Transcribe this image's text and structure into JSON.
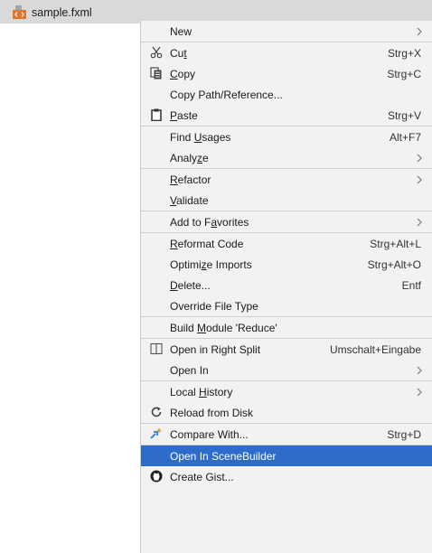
{
  "file": {
    "name": "sample.fxml",
    "icon": "fxml-file-icon"
  },
  "colors": {
    "menu_background": "#f2f2f2",
    "selection": "#2e6cc9",
    "separator": "#cfcfcf",
    "file_row_highlight": "#d9d9d9"
  },
  "menu": {
    "groups": [
      {
        "items": [
          {
            "label": "New",
            "mnemonic": "",
            "shortcut": "",
            "submenu": true,
            "icon": ""
          }
        ]
      },
      {
        "items": [
          {
            "label_pre": "Cu",
            "label_u": "t",
            "label_post": "",
            "shortcut": "Strg+X",
            "submenu": false,
            "icon": "scissors-icon"
          },
          {
            "label_pre": "",
            "label_u": "C",
            "label_post": "opy",
            "shortcut": "Strg+C",
            "submenu": false,
            "icon": "copy-icon"
          },
          {
            "label_pre": "Copy Path/Reference...",
            "label_u": "",
            "label_post": "",
            "shortcut": "",
            "submenu": false,
            "icon": ""
          },
          {
            "label_pre": "",
            "label_u": "P",
            "label_post": "aste",
            "shortcut": "Strg+V",
            "submenu": false,
            "icon": "clipboard-icon"
          }
        ]
      },
      {
        "items": [
          {
            "label_pre": "Find ",
            "label_u": "U",
            "label_post": "sages",
            "shortcut": "Alt+F7",
            "submenu": false,
            "icon": ""
          },
          {
            "label_pre": "Analy",
            "label_u": "z",
            "label_post": "e",
            "shortcut": "",
            "submenu": true,
            "icon": ""
          }
        ]
      },
      {
        "items": [
          {
            "label_pre": "",
            "label_u": "R",
            "label_post": "efactor",
            "shortcut": "",
            "submenu": true,
            "icon": ""
          },
          {
            "label_pre": "",
            "label_u": "V",
            "label_post": "alidate",
            "shortcut": "",
            "submenu": false,
            "icon": ""
          }
        ]
      },
      {
        "items": [
          {
            "label_pre": "Add to F",
            "label_u": "a",
            "label_post": "vorites",
            "shortcut": "",
            "submenu": true,
            "icon": ""
          }
        ]
      },
      {
        "items": [
          {
            "label_pre": "",
            "label_u": "R",
            "label_post": "eformat Code",
            "shortcut": "Strg+Alt+L",
            "submenu": false,
            "icon": ""
          },
          {
            "label_pre": "Optimi",
            "label_u": "z",
            "label_post": "e Imports",
            "shortcut": "Strg+Alt+O",
            "submenu": false,
            "icon": ""
          },
          {
            "label_pre": "",
            "label_u": "D",
            "label_post": "elete...",
            "shortcut": "Entf",
            "submenu": false,
            "icon": ""
          },
          {
            "label_pre": "Override File Type",
            "label_u": "",
            "label_post": "",
            "shortcut": "",
            "submenu": false,
            "icon": ""
          }
        ]
      },
      {
        "items": [
          {
            "label_pre": "Build ",
            "label_u": "M",
            "label_post": "odule 'Reduce'",
            "shortcut": "",
            "submenu": false,
            "icon": ""
          }
        ]
      },
      {
        "items": [
          {
            "label_pre": "Open in Right Split",
            "label_u": "",
            "label_post": "",
            "shortcut": "Umschalt+Eingabe",
            "submenu": false,
            "icon": "split-icon"
          },
          {
            "label_pre": "Open In",
            "label_u": "",
            "label_post": "",
            "shortcut": "",
            "submenu": true,
            "icon": ""
          }
        ]
      },
      {
        "items": [
          {
            "label_pre": "Local ",
            "label_u": "H",
            "label_post": "istory",
            "shortcut": "",
            "submenu": true,
            "icon": ""
          },
          {
            "label_pre": "Reload from Disk",
            "label_u": "",
            "label_post": "",
            "shortcut": "",
            "submenu": false,
            "icon": "reload-icon"
          }
        ]
      },
      {
        "items": [
          {
            "label_pre": "Compare With...",
            "label_u": "",
            "label_post": "",
            "shortcut": "Strg+D",
            "submenu": false,
            "icon": "compare-icon"
          }
        ]
      },
      {
        "items": [
          {
            "label_pre": "Open In SceneBuilder",
            "label_u": "",
            "label_post": "",
            "shortcut": "",
            "submenu": false,
            "icon": "",
            "selected": true
          },
          {
            "label_pre": "Create Gist...",
            "label_u": "",
            "label_post": "",
            "shortcut": "",
            "submenu": false,
            "icon": "github-icon"
          }
        ]
      }
    ]
  },
  "labels": {
    "new": "New",
    "cut_pre": "Cu",
    "cut_u": "t",
    "cut_sc": "Strg+X",
    "copy_u": "C",
    "copy_post": "opy",
    "copy_sc": "Strg+C",
    "copy_path": "Copy Path/Reference...",
    "paste_u": "P",
    "paste_post": "aste",
    "paste_sc": "Strg+V",
    "find_pre": "Find ",
    "find_u": "U",
    "find_post": "sages",
    "find_sc": "Alt+F7",
    "analyze_pre": "Analy",
    "analyze_u": "z",
    "analyze_post": "e",
    "refactor_u": "R",
    "refactor_post": "efactor",
    "validate_u": "V",
    "validate_post": "alidate",
    "fav_pre": "Add to F",
    "fav_u": "a",
    "fav_post": "vorites",
    "reformat_u": "R",
    "reformat_post": "eformat Code",
    "reformat_sc": "Strg+Alt+L",
    "optimize_pre": "Optimi",
    "optimize_u": "z",
    "optimize_post": "e Imports",
    "optimize_sc": "Strg+Alt+O",
    "delete_u": "D",
    "delete_post": "elete...",
    "delete_sc": "Entf",
    "override": "Override File Type",
    "build_pre": "Build ",
    "build_u": "M",
    "build_post": "odule 'Reduce'",
    "split": "Open in Right Split",
    "split_sc": "Umschalt+Eingabe",
    "open_in": "Open In",
    "history_pre": "Local ",
    "history_u": "H",
    "history_post": "istory",
    "reload": "Reload from Disk",
    "compare": "Compare With...",
    "compare_sc": "Strg+D",
    "scenebuilder": "Open In SceneBuilder",
    "gist": "Create Gist..."
  }
}
